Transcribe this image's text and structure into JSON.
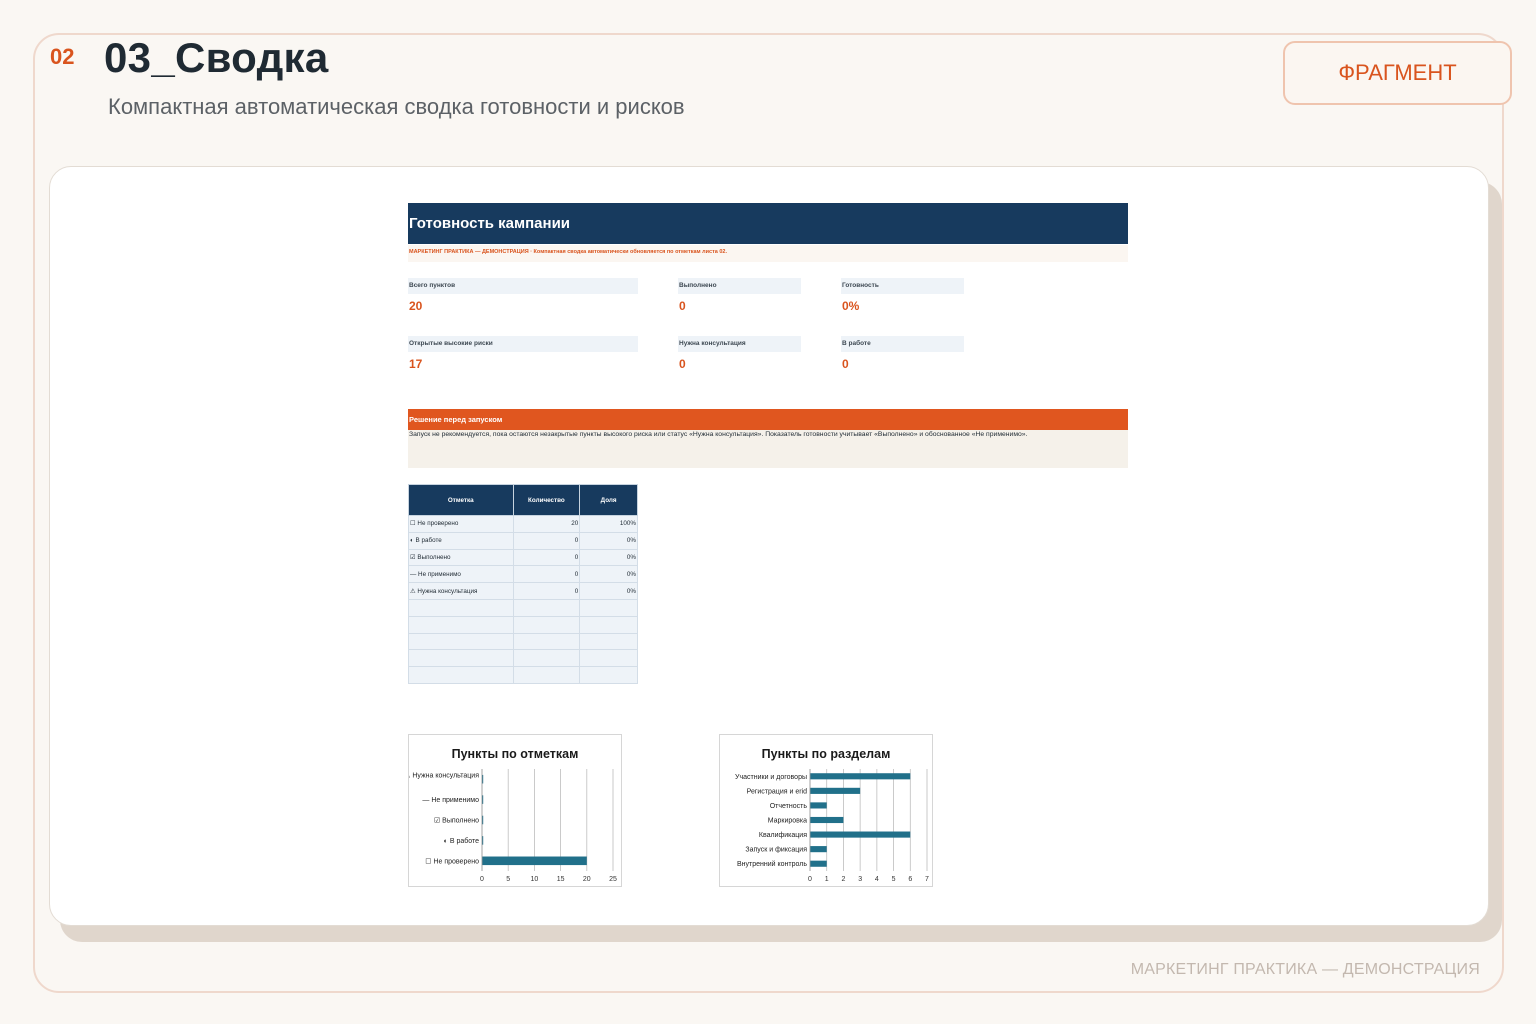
{
  "slide": {
    "number": "02",
    "title": "03_Сводка",
    "subtitle": "Компактная автоматическая сводка готовности и рисков",
    "tag_label": "ФРАГМЕНТ",
    "footer": "МАРКЕТИНГ ПРАКТИКА — ДЕМОНСТРАЦИЯ"
  },
  "sheet": {
    "title": "Готовность кампании",
    "note": "МАРКЕТИНГ ПРАКТИКА — ДЕМОНСТРАЦИЯ · Компактная сводка автоматически обновляется по отметкам листа 02.",
    "kpis": [
      {
        "label": "Всего пунктов",
        "value": "20"
      },
      {
        "label": "Выполнено",
        "value": "0"
      },
      {
        "label": "Готовность",
        "value": "0%"
      },
      {
        "label": "Открытые высокие риски",
        "value": "17"
      },
      {
        "label": "Нужна консультация",
        "value": "0"
      },
      {
        "label": "В работе",
        "value": "0"
      }
    ],
    "decision": {
      "title": "Решение перед запуском",
      "text": "Запуск не рекомендуется, пока остаются незакрытые пункты высокого риска или статус «Нужна консультация». Показатель готовности учитывает «Выполнено» и обоснованное «Не применимо»."
    },
    "table": {
      "headers": [
        "Отметка",
        "Количество",
        "Доля"
      ],
      "rows": [
        [
          "☐ Не проверено",
          "20",
          "100%"
        ],
        [
          "◐ В работе",
          "0",
          "0%"
        ],
        [
          "☑ Выполнено",
          "0",
          "0%"
        ],
        [
          "— Не применимо",
          "0",
          "0%"
        ],
        [
          "⚠ Нужна консультация",
          "0",
          "0%"
        ]
      ]
    }
  },
  "chart_data": [
    {
      "type": "bar",
      "orientation": "horizontal",
      "title": "Пункты по отметкам",
      "categories": [
        "⚠ Нужна консультация",
        "— Не применимо",
        "☑ Выполнено",
        "◐ В работе",
        "☐ Не проверено"
      ],
      "values": [
        0,
        0,
        0,
        0,
        20
      ],
      "xlim": [
        0,
        25
      ],
      "xticks": [
        0,
        5,
        10,
        15,
        20,
        25
      ],
      "grid": true,
      "color": "#21708a"
    },
    {
      "type": "bar",
      "orientation": "horizontal",
      "title": "Пункты по разделам",
      "categories": [
        "Участники и договоры",
        "Регистрация и erid",
        "Отчетность",
        "Маркировка",
        "Квалификация",
        "Запуск и фиксация",
        "Внутренний контроль"
      ],
      "values": [
        6,
        3,
        1,
        2,
        6,
        1,
        1
      ],
      "xlim": [
        0,
        7
      ],
      "xticks": [
        0,
        1,
        2,
        3,
        4,
        5,
        6,
        7
      ],
      "grid": true,
      "color": "#21708a"
    }
  ]
}
